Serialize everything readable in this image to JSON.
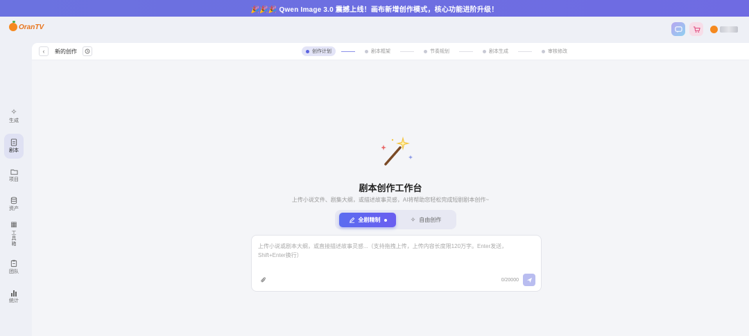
{
  "banner": {
    "text": "🎉🎉🎉 Qwen Image 3.0 震撼上线！画布新增创作模式，核心功能进阶升级！"
  },
  "app": {
    "logo_text": "OranTV"
  },
  "topbar": {
    "chat_icon": "chat-icon",
    "cart_icon": "cart-icon"
  },
  "sidebar": {
    "items": [
      {
        "label": "生成",
        "icon": "sparkle-icon",
        "active": false
      },
      {
        "label": "剧本",
        "icon": "document-icon",
        "active": true
      },
      {
        "label": "项目",
        "icon": "folder-icon",
        "active": false
      },
      {
        "label": "资产",
        "icon": "database-icon",
        "active": false
      },
      {
        "label": "工具箱",
        "icon": "grid-icon",
        "active": false
      },
      {
        "label": "团队",
        "icon": "team-icon",
        "active": false
      },
      {
        "label": "统计",
        "icon": "chart-icon",
        "active": false
      }
    ]
  },
  "header": {
    "title": "新的创作",
    "steps": [
      "创作计划",
      "剧本框架",
      "节奏规划",
      "剧本生成",
      "审核修改"
    ]
  },
  "main": {
    "title": "剧本创作工作台",
    "subtitle": "上传小说文件、剧集大纲，或描述故事灵感，AI将帮助您轻松完成短剧剧本创作~",
    "mode_primary": "全剧精制",
    "mode_secondary": "自由创作"
  },
  "composer": {
    "placeholder_line1": "上传小说或剧本大纲，或直接描述故事灵感...（支持拖拽上传，上传内容长度限120万字。Enter发送，",
    "placeholder_line2": "Shift+Enter换行）",
    "counter": "0/20000"
  },
  "colors": {
    "banner": "#6b72e0",
    "accent": "#5b63e0",
    "brand": "#f5891f"
  }
}
